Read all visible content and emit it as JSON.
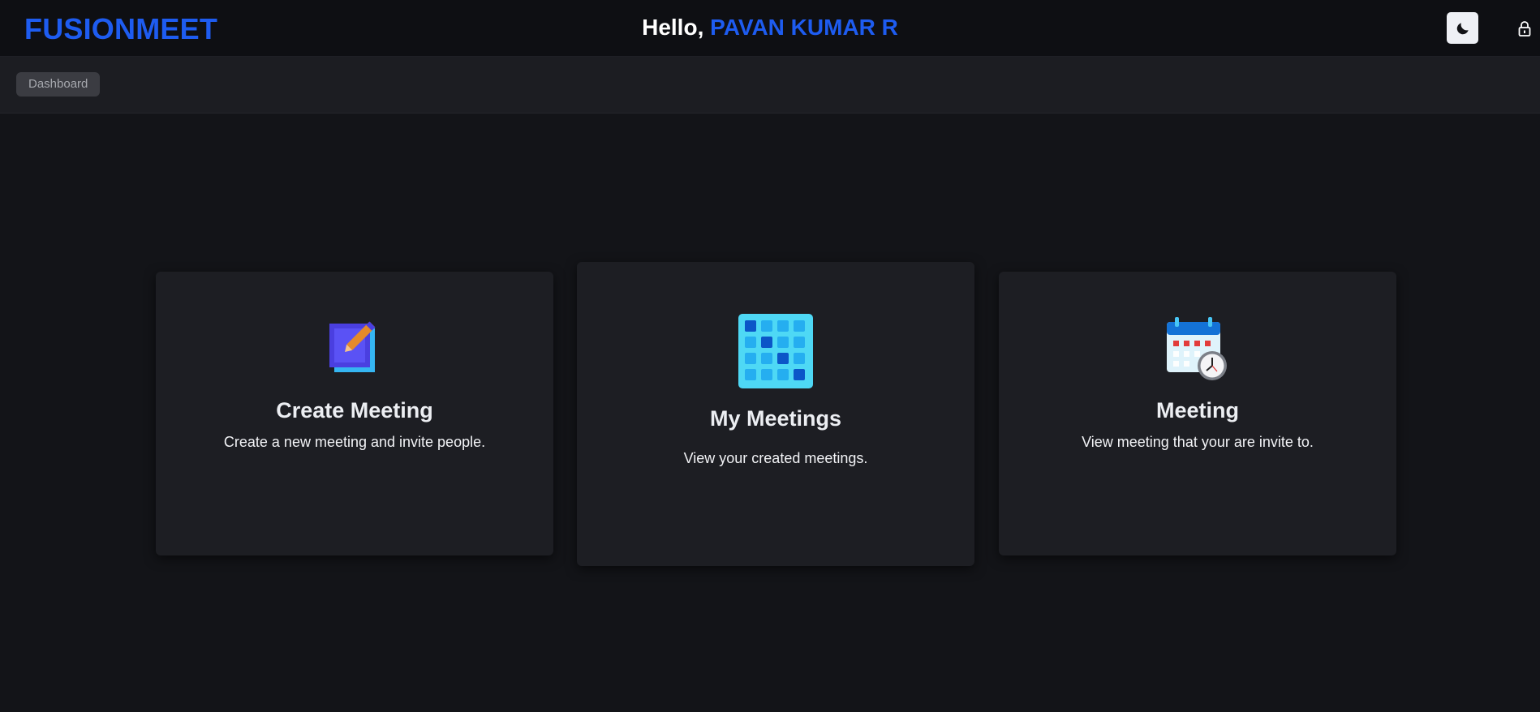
{
  "header": {
    "brand": "FUSIONMEET",
    "greeting_prefix": "Hello, ",
    "user_name": "PAVAN KUMAR R",
    "theme_toggle_icon": "moon-icon",
    "lock_icon": "lock-icon"
  },
  "breadcrumb": {
    "label": "Dashboard"
  },
  "cards": [
    {
      "icon": "create-meeting-icon",
      "title": "Create Meeting",
      "description": "Create a new meeting and invite people."
    },
    {
      "icon": "calendar-grid-icon",
      "title": "My Meetings",
      "description": "View your created meetings."
    },
    {
      "icon": "calendar-clock-icon",
      "title": "Meeting",
      "description": "View meeting that your are invite to."
    }
  ],
  "colors": {
    "accent": "#1e5cf0",
    "background": "#131418",
    "card": "#1d1e23"
  }
}
